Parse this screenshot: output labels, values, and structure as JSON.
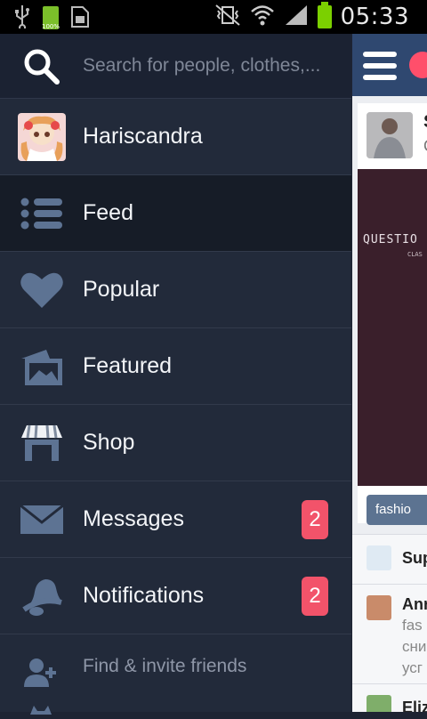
{
  "status_bar": {
    "time": "05:33",
    "battery_small_label": "100%"
  },
  "search": {
    "placeholder": "Search for people, clothes,..."
  },
  "menu": {
    "profile": "Hariscandra",
    "feed": "Feed",
    "popular": "Popular",
    "featured": "Featured",
    "shop": "Shop",
    "messages": "Messages",
    "messages_badge": "2",
    "notifications": "Notifications",
    "notifications_badge": "2",
    "find_invite": "Find & invite friends"
  },
  "content_peek": {
    "card_initial": "S",
    "card_sub": "C",
    "image_text": "QUESTIO",
    "image_subtext": "CLAS",
    "tag_text": "fashio",
    "row1_name": "Sup",
    "row2_name": "Anr",
    "row2_sub1": "fas",
    "row2_sub2": "сни",
    "row2_sub3": "усг",
    "row3_name": "Eliz"
  },
  "colors": {
    "drawer_bg": "#222a3a",
    "active_bg": "#161c27",
    "badge": "#f2536a",
    "icon": "#5d7393"
  }
}
